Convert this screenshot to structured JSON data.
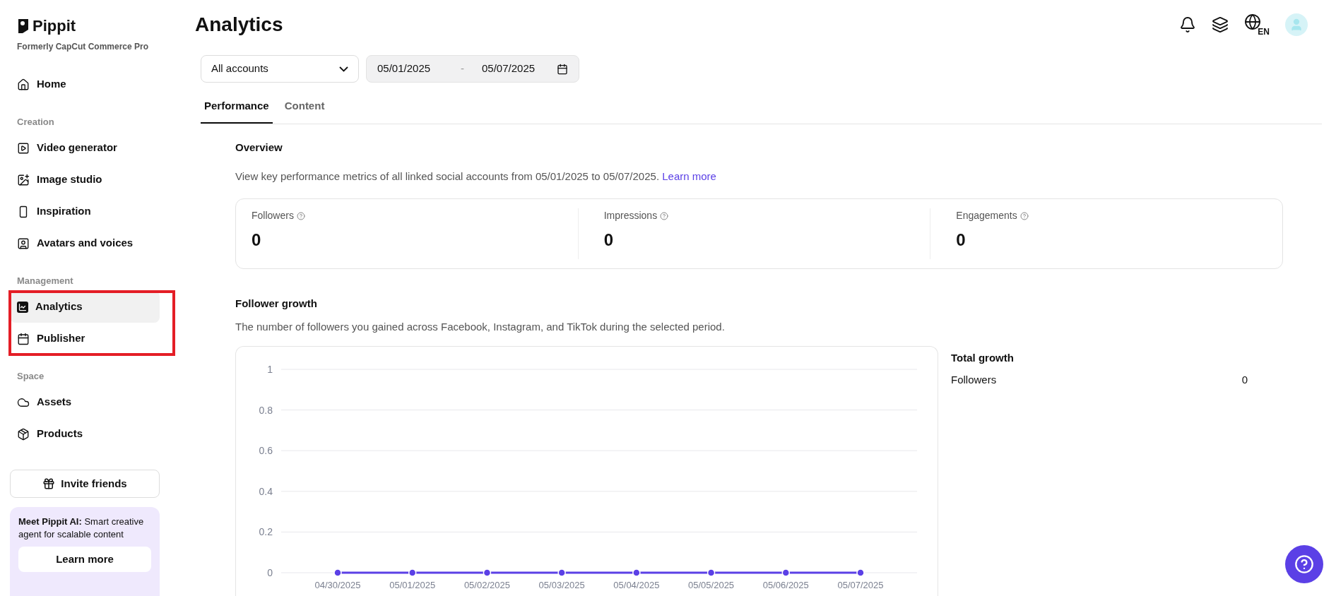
{
  "brand": {
    "name": "Pippit",
    "tagline": "Formerly CapCut Commerce Pro"
  },
  "sidebar": {
    "sections": [
      {
        "items": [
          {
            "label": "Home",
            "selected": false
          }
        ]
      },
      {
        "label": "Creation",
        "items": [
          {
            "label": "Video generator",
            "selected": false
          },
          {
            "label": "Image studio",
            "selected": false
          },
          {
            "label": "Inspiration",
            "selected": false
          },
          {
            "label": "Avatars and voices",
            "selected": false
          }
        ]
      },
      {
        "label": "Management",
        "highlighted": true,
        "items": [
          {
            "label": "Analytics",
            "selected": true
          },
          {
            "label": "Publisher",
            "selected": false
          }
        ]
      },
      {
        "label": "Space",
        "items": [
          {
            "label": "Assets",
            "selected": false
          },
          {
            "label": "Products",
            "selected": false
          }
        ]
      }
    ],
    "invite_button": "Invite friends",
    "promo": {
      "text": "**Meet Pippit AI:** Smart creative agent for scalable content",
      "button": "Learn more"
    }
  },
  "header": {
    "title": "Analytics",
    "language": "EN"
  },
  "filters": {
    "account": "All accounts",
    "date_from": "05/01/2025",
    "date_separator": "-",
    "date_to": "05/07/2025"
  },
  "tabs": [
    {
      "label": "Performance",
      "selected": true
    },
    {
      "label": "Content",
      "selected": false
    }
  ],
  "overview": {
    "title": "Overview",
    "description": "View key performance metrics of all linked social accounts from 05/01/2025 to 05/07/2025.",
    "link": "Learn more",
    "metrics": [
      {
        "label": "Followers",
        "value": "0"
      },
      {
        "label": "Impressions",
        "value": "0"
      },
      {
        "label": "Engagements",
        "value": "0"
      }
    ]
  },
  "follower_growth": {
    "title": "Follower growth",
    "description": "The number of followers you gained across Facebook, Instagram, and TikTok during the selected period.",
    "chart_data": {
      "type": "line",
      "grid": true,
      "categories": [
        "04/30/2025",
        "05/01/2025",
        "05/02/2025",
        "05/03/2025",
        "05/04/2025",
        "05/05/2025",
        "05/06/2025",
        "05/07/2025"
      ],
      "series": [
        {
          "color": "#5b40e6",
          "marker": "circle",
          "values": [
            0,
            0,
            0,
            0,
            0,
            0,
            0,
            0
          ]
        }
      ],
      "ylim": [
        0,
        1
      ],
      "yticks": [
        0,
        0.2,
        0.4,
        0.6,
        0.8,
        1
      ]
    },
    "total": {
      "title": "Total growth",
      "rows": [
        {
          "label": "Followers",
          "value": "0"
        }
      ]
    }
  }
}
